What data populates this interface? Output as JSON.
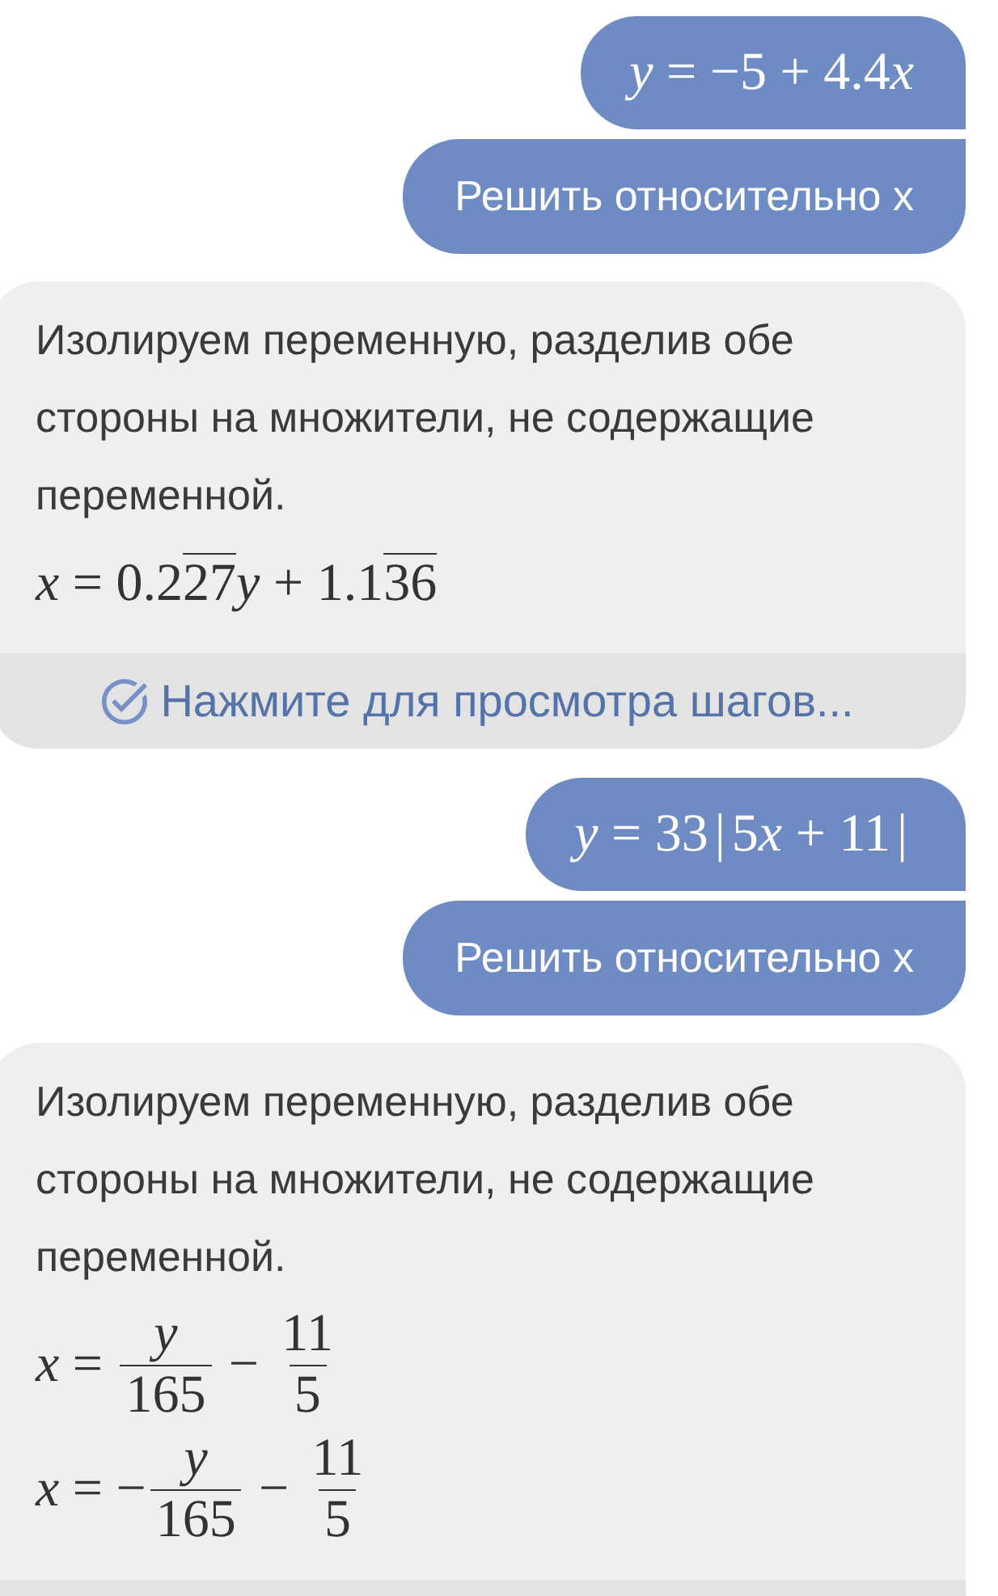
{
  "messages": [
    {
      "kind": "query",
      "math": [
        {
          "kind": "var",
          "text": "y"
        },
        {
          "kind": "op",
          "text": "="
        },
        {
          "kind": "num",
          "text": "−5"
        },
        {
          "kind": "op",
          "text": "+"
        },
        {
          "kind": "num",
          "text": "4.4"
        },
        {
          "kind": "var",
          "text": "x"
        }
      ]
    },
    {
      "kind": "command",
      "text": "Решить относительно x"
    },
    {
      "kind": "answer",
      "explanation": "Изолируем переменную, разделив обе стороны на множители, не содержащие переменной.",
      "equations": [
        {
          "math": [
            {
              "kind": "var",
              "text": "x"
            },
            {
              "kind": "op",
              "text": "="
            },
            {
              "kind": "num",
              "text": "0.2"
            },
            {
              "kind": "repeat",
              "text": "27"
            },
            {
              "kind": "var",
              "text": "y"
            },
            {
              "kind": "op",
              "text": "+"
            },
            {
              "kind": "num",
              "text": "1.1"
            },
            {
              "kind": "repeat",
              "text": "36"
            }
          ]
        }
      ],
      "steps_bar": true,
      "steps_label": "Нажмите для просмотра шагов..."
    },
    {
      "kind": "query",
      "math": [
        {
          "kind": "var",
          "text": "y"
        },
        {
          "kind": "op",
          "text": "="
        },
        {
          "kind": "num",
          "text": "33"
        },
        {
          "kind": "delim",
          "text": "|"
        },
        {
          "kind": "num",
          "text": "5"
        },
        {
          "kind": "var",
          "text": "x"
        },
        {
          "kind": "op",
          "text": "+"
        },
        {
          "kind": "num",
          "text": "11"
        },
        {
          "kind": "delim",
          "text": "|"
        }
      ]
    },
    {
      "kind": "command",
      "text": "Решить относительно x"
    },
    {
      "kind": "answer",
      "explanation": "Изолируем переменную, разделив обе стороны на множители, не содержащие переменной.",
      "equations": [
        {
          "math": [
            {
              "kind": "var",
              "text": "x"
            },
            {
              "kind": "op",
              "text": "="
            },
            {
              "kind": "frac",
              "num": [
                {
                  "kind": "var",
                  "text": "y"
                }
              ],
              "den": [
                {
                  "kind": "num",
                  "text": "165"
                }
              ]
            },
            {
              "kind": "op",
              "text": "−"
            },
            {
              "kind": "frac",
              "num": [
                {
                  "kind": "num",
                  "text": "11"
                }
              ],
              "den": [
                {
                  "kind": "num",
                  "text": "5"
                }
              ]
            }
          ]
        },
        {
          "math": [
            {
              "kind": "var",
              "text": "x"
            },
            {
              "kind": "op",
              "text": "="
            },
            {
              "kind": "num",
              "text": "−"
            },
            {
              "kind": "frac",
              "num": [
                {
                  "kind": "var",
                  "text": "y"
                }
              ],
              "den": [
                {
                  "kind": "num",
                  "text": "165"
                }
              ]
            },
            {
              "kind": "op",
              "text": "−"
            },
            {
              "kind": "frac",
              "num": [
                {
                  "kind": "num",
                  "text": "11"
                }
              ],
              "den": [
                {
                  "kind": "num",
                  "text": "5"
                }
              ]
            }
          ]
        }
      ],
      "steps_bar": true
    }
  ]
}
